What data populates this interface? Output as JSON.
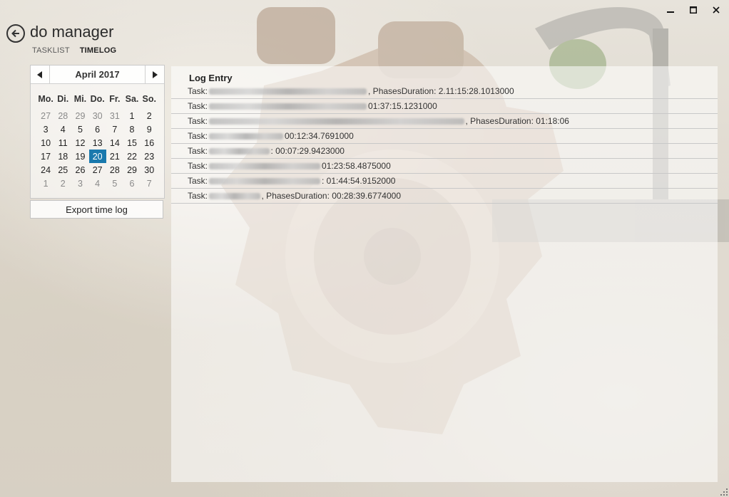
{
  "app": {
    "title": "do manager"
  },
  "tabs": [
    {
      "label": "TASKLIST",
      "active": false
    },
    {
      "label": "TIMELOG",
      "active": true
    }
  ],
  "calendar": {
    "month_label": "April 2017",
    "weekdays": [
      "Mo.",
      "Di.",
      "Mi.",
      "Do.",
      "Fr.",
      "Sa.",
      "So."
    ],
    "days": [
      {
        "d": "27",
        "dim": true
      },
      {
        "d": "28",
        "dim": true
      },
      {
        "d": "29",
        "dim": true
      },
      {
        "d": "30",
        "dim": true
      },
      {
        "d": "31",
        "dim": true
      },
      {
        "d": "1"
      },
      {
        "d": "2"
      },
      {
        "d": "3"
      },
      {
        "d": "4"
      },
      {
        "d": "5"
      },
      {
        "d": "6"
      },
      {
        "d": "7"
      },
      {
        "d": "8"
      },
      {
        "d": "9"
      },
      {
        "d": "10"
      },
      {
        "d": "11"
      },
      {
        "d": "12"
      },
      {
        "d": "13"
      },
      {
        "d": "14"
      },
      {
        "d": "15"
      },
      {
        "d": "16"
      },
      {
        "d": "17"
      },
      {
        "d": "18"
      },
      {
        "d": "19"
      },
      {
        "d": "20",
        "selected": true
      },
      {
        "d": "21"
      },
      {
        "d": "22"
      },
      {
        "d": "23"
      },
      {
        "d": "24"
      },
      {
        "d": "25"
      },
      {
        "d": "26"
      },
      {
        "d": "27"
      },
      {
        "d": "28"
      },
      {
        "d": "29"
      },
      {
        "d": "30"
      },
      {
        "d": "1",
        "dim": true
      },
      {
        "d": "2",
        "dim": true
      },
      {
        "d": "3",
        "dim": true
      },
      {
        "d": "4",
        "dim": true
      },
      {
        "d": "5",
        "dim": true
      },
      {
        "d": "6",
        "dim": true
      },
      {
        "d": "7",
        "dim": true
      }
    ],
    "selected_color": "#1a79ad"
  },
  "export_button": "Export time log",
  "log": {
    "header": "Log Entry",
    "rows": [
      {
        "prefix": "Task:",
        "blur_units": 34,
        "suffix": ", PhasesDuration: 2.11:15:28.1013000"
      },
      {
        "prefix": "Task:",
        "blur_units": 34,
        "suffix": " 01:37:15.1231000"
      },
      {
        "prefix": "Task:",
        "blur_units": 55,
        "suffix": ", PhasesDuration: 01:18:06"
      },
      {
        "prefix": "Task:",
        "blur_units": 16,
        "suffix": " 00:12:34.7691000"
      },
      {
        "prefix": "Task:",
        "blur_units": 13,
        "suffix": ": 00:07:29.9423000"
      },
      {
        "prefix": "Task:",
        "blur_units": 24,
        "suffix": " 01:23:58.4875000"
      },
      {
        "prefix": "Task:",
        "blur_units": 24,
        "suffix": ": 01:44:54.9152000"
      },
      {
        "prefix": "Task:",
        "blur_units": 11,
        "suffix": ", PhasesDuration: 00:28:39.6774000"
      }
    ]
  },
  "icons": {
    "back": "back-arrow-icon",
    "minimize": "minimize-icon",
    "maximize": "maximize-icon",
    "close": "close-icon",
    "prev": "chevron-left-icon",
    "next": "chevron-right-icon"
  }
}
